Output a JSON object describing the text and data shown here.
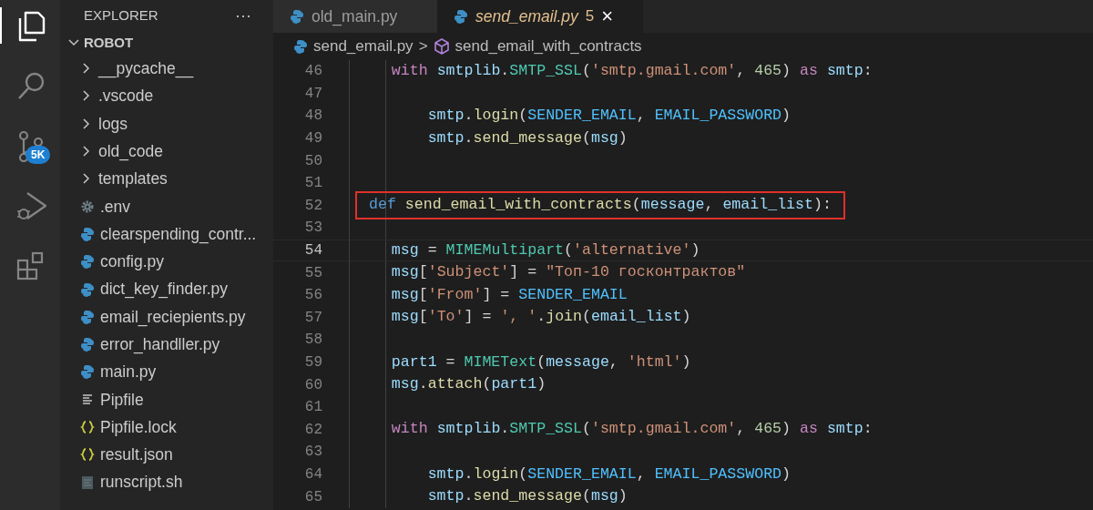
{
  "activity_bar": [
    {
      "kind": "files",
      "selected": true
    },
    {
      "kind": "search",
      "selected": false
    },
    {
      "kind": "source_control",
      "selected": false,
      "badge": "5K"
    },
    {
      "kind": "run_debug",
      "selected": false
    },
    {
      "kind": "extensions",
      "selected": false
    }
  ],
  "explorer": {
    "title": "EXPLORER",
    "menu": "···",
    "root": {
      "label": "ROBOT",
      "expanded": true,
      "children": [
        {
          "kind": "folder",
          "label": "__pycache__",
          "expanded": false
        },
        {
          "kind": "folder",
          "label": ".vscode",
          "expanded": false
        },
        {
          "kind": "folder",
          "label": "logs",
          "expanded": false
        },
        {
          "kind": "folder",
          "label": "old_code",
          "expanded": false
        },
        {
          "kind": "folder",
          "label": "templates",
          "expanded": false
        },
        {
          "kind": "settings",
          "label": ".env"
        },
        {
          "kind": "python",
          "label": "clearspending_contr..."
        },
        {
          "kind": "python",
          "label": "config.py"
        },
        {
          "kind": "python",
          "label": "dict_key_finder.py"
        },
        {
          "kind": "python",
          "label": "email_reciepients.py"
        },
        {
          "kind": "python",
          "label": "error_handller.py"
        },
        {
          "kind": "python",
          "label": "main.py"
        },
        {
          "kind": "text",
          "label": "Pipfile"
        },
        {
          "kind": "json",
          "label": "Pipfile.lock"
        },
        {
          "kind": "json",
          "label": "result.json"
        },
        {
          "kind": "shell",
          "label": "runscript.sh"
        }
      ]
    }
  },
  "tabs": [
    {
      "label": "old_main.py",
      "selected": false
    },
    {
      "label": "send_email.py",
      "selected": true,
      "problems": "5",
      "close": "×"
    }
  ],
  "breadcrumb": {
    "file": "send_email.py",
    "separator": ">",
    "symbol": "send_email_with_contracts"
  },
  "lines": [
    {
      "number": "46",
      "tokens": [
        {
          "kind": "kw",
          "text": "    with"
        },
        {
          "kind": "var",
          "text": " smtplib"
        },
        {
          "kind": "p",
          "text": "."
        },
        {
          "kind": "cls",
          "text": "SMTP_SSL"
        },
        {
          "kind": "p",
          "text": "("
        },
        {
          "kind": "str",
          "text": "'smtp.gmail.com'"
        },
        {
          "kind": "p",
          "text": ", "
        },
        {
          "kind": "num",
          "text": "465"
        },
        {
          "kind": "p",
          "text": ") "
        },
        {
          "kind": "kw",
          "text": "as"
        },
        {
          "kind": "var",
          "text": " smtp"
        },
        {
          "kind": "p",
          "text": ":"
        }
      ]
    },
    {
      "number": "47"
    },
    {
      "number": "48",
      "tokens": [
        {
          "kind": "var",
          "text": "        smtp"
        },
        {
          "kind": "p",
          "text": "."
        },
        {
          "kind": "fn",
          "text": "login"
        },
        {
          "kind": "p",
          "text": "("
        },
        {
          "kind": "const",
          "text": "SENDER_EMAIL"
        },
        {
          "kind": "p",
          "text": ", "
        },
        {
          "kind": "const",
          "text": "EMAIL_PASSWORD"
        },
        {
          "kind": "p",
          "text": ")"
        }
      ]
    },
    {
      "number": "49",
      "tokens": [
        {
          "kind": "var",
          "text": "        smtp"
        },
        {
          "kind": "p",
          "text": "."
        },
        {
          "kind": "fn",
          "text": "send_message"
        },
        {
          "kind": "p",
          "text": "("
        },
        {
          "kind": "var",
          "text": "msg"
        },
        {
          "kind": "p",
          "text": ")"
        }
      ]
    },
    {
      "number": "50"
    },
    {
      "number": "51"
    },
    {
      "number": "52",
      "highlighted": true,
      "tokens": [
        {
          "kind": "def",
          "text": "def"
        },
        {
          "kind": "fn",
          "text": " send_email_with_contracts"
        },
        {
          "kind": "p",
          "text": "("
        },
        {
          "kind": "var",
          "text": "message"
        },
        {
          "kind": "p",
          "text": ", "
        },
        {
          "kind": "var",
          "text": "email_list"
        },
        {
          "kind": "p",
          "text": "):"
        }
      ]
    },
    {
      "number": "53"
    },
    {
      "number": "54",
      "current": true,
      "tokens": [
        {
          "kind": "var",
          "text": "    msg"
        },
        {
          "kind": "p",
          "text": " = "
        },
        {
          "kind": "cls",
          "text": "MIMEMultipart"
        },
        {
          "kind": "p",
          "text": "("
        },
        {
          "kind": "str",
          "text": "'alternative'"
        },
        {
          "kind": "p",
          "text": ")"
        }
      ]
    },
    {
      "number": "55",
      "tokens": [
        {
          "kind": "var",
          "text": "    msg"
        },
        {
          "kind": "p",
          "text": "["
        },
        {
          "kind": "str",
          "text": "'Subject'"
        },
        {
          "kind": "p",
          "text": "] = "
        },
        {
          "kind": "str",
          "text": "\"Топ-10 госконтрактов\""
        }
      ]
    },
    {
      "number": "56",
      "tokens": [
        {
          "kind": "var",
          "text": "    msg"
        },
        {
          "kind": "p",
          "text": "["
        },
        {
          "kind": "str",
          "text": "'From'"
        },
        {
          "kind": "p",
          "text": "] = "
        },
        {
          "kind": "const",
          "text": "SENDER_EMAIL"
        }
      ]
    },
    {
      "number": "57",
      "tokens": [
        {
          "kind": "var",
          "text": "    msg"
        },
        {
          "kind": "p",
          "text": "["
        },
        {
          "kind": "str",
          "text": "'To'"
        },
        {
          "kind": "p",
          "text": "] = "
        },
        {
          "kind": "str",
          "text": "', '"
        },
        {
          "kind": "p",
          "text": "."
        },
        {
          "kind": "fn",
          "text": "join"
        },
        {
          "kind": "p",
          "text": "("
        },
        {
          "kind": "var",
          "text": "email_list"
        },
        {
          "kind": "p",
          "text": ")"
        }
      ]
    },
    {
      "number": "58"
    },
    {
      "number": "59",
      "tokens": [
        {
          "kind": "var",
          "text": "    part1"
        },
        {
          "kind": "p",
          "text": " = "
        },
        {
          "kind": "cls",
          "text": "MIMEText"
        },
        {
          "kind": "p",
          "text": "("
        },
        {
          "kind": "var",
          "text": "message"
        },
        {
          "kind": "p",
          "text": ", "
        },
        {
          "kind": "str",
          "text": "'html'"
        },
        {
          "kind": "p",
          "text": ")"
        }
      ]
    },
    {
      "number": "60",
      "tokens": [
        {
          "kind": "var",
          "text": "    msg"
        },
        {
          "kind": "p",
          "text": "."
        },
        {
          "kind": "fn",
          "text": "attach"
        },
        {
          "kind": "p",
          "text": "("
        },
        {
          "kind": "var",
          "text": "part1"
        },
        {
          "kind": "p",
          "text": ")"
        }
      ]
    },
    {
      "number": "61"
    },
    {
      "number": "62",
      "tokens": [
        {
          "kind": "kw",
          "text": "    with"
        },
        {
          "kind": "var",
          "text": " smtplib"
        },
        {
          "kind": "p",
          "text": "."
        },
        {
          "kind": "cls",
          "text": "SMTP_SSL"
        },
        {
          "kind": "p",
          "text": "("
        },
        {
          "kind": "str",
          "text": "'smtp.gmail.com'"
        },
        {
          "kind": "p",
          "text": ", "
        },
        {
          "kind": "num",
          "text": "465"
        },
        {
          "kind": "p",
          "text": ") "
        },
        {
          "kind": "kw",
          "text": "as"
        },
        {
          "kind": "var",
          "text": " smtp"
        },
        {
          "kind": "p",
          "text": ":"
        }
      ]
    },
    {
      "number": "63"
    },
    {
      "number": "64",
      "tokens": [
        {
          "kind": "var",
          "text": "        smtp"
        },
        {
          "kind": "p",
          "text": "."
        },
        {
          "kind": "fn",
          "text": "login"
        },
        {
          "kind": "p",
          "text": "("
        },
        {
          "kind": "const",
          "text": "SENDER_EMAIL"
        },
        {
          "kind": "p",
          "text": ", "
        },
        {
          "kind": "const",
          "text": "EMAIL_PASSWORD"
        },
        {
          "kind": "p",
          "text": ")"
        }
      ]
    },
    {
      "number": "65",
      "tokens": [
        {
          "kind": "var",
          "text": "        smtp"
        },
        {
          "kind": "p",
          "text": "."
        },
        {
          "kind": "fn",
          "text": "send_message"
        },
        {
          "kind": "p",
          "text": "("
        },
        {
          "kind": "var",
          "text": "msg"
        },
        {
          "kind": "p",
          "text": ")"
        }
      ]
    }
  ]
}
